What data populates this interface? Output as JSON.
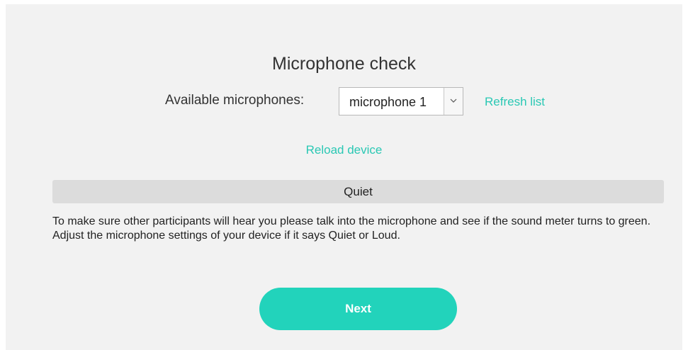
{
  "mic_check": {
    "title": "Microphone check",
    "available_label": "Available microphones:",
    "selected_microphone": "microphone 1",
    "refresh_label": "Refresh list",
    "reload_label": "Reload device",
    "meter_status": "Quiet",
    "instructions": "To make sure other participants will hear you please talk into the microphone and see if the sound meter turns to green. Adjust the microphone settings of your device if it says Quiet or Loud.",
    "next_label": "Next"
  },
  "colors": {
    "accent": "#22d3bb",
    "link": "#2ac8b4",
    "panel_background": "#f2f2f2",
    "meter_background": "#dcdcdc"
  },
  "icons": {
    "select_arrow": "chevron-down-icon"
  }
}
